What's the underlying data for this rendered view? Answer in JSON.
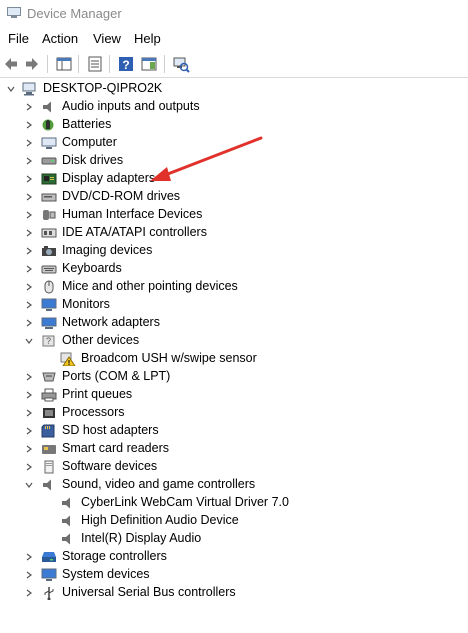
{
  "window": {
    "title": "Device Manager"
  },
  "menu": {
    "file": "File",
    "action": "Action",
    "view": "View",
    "help": "Help"
  },
  "toolbar": {
    "buttons": [
      "back-icon",
      "forward-icon",
      "show-hide-console-tree-icon",
      "properties-icon",
      "help-icon",
      "action-pane-icon",
      "scan-hardware-icon"
    ]
  },
  "tree": {
    "root": "DESKTOP-QIPRO2K",
    "categories": [
      {
        "label": "Audio inputs and outputs",
        "icon": "speaker-icon",
        "expanded": false
      },
      {
        "label": "Batteries",
        "icon": "battery-icon",
        "expanded": false
      },
      {
        "label": "Computer",
        "icon": "computer-icon",
        "expanded": false
      },
      {
        "label": "Disk drives",
        "icon": "disk-drive-icon",
        "expanded": false
      },
      {
        "label": "Display adapters",
        "icon": "display-adapter-icon",
        "expanded": false
      },
      {
        "label": "DVD/CD-ROM drives",
        "icon": "dvd-drive-icon",
        "expanded": false
      },
      {
        "label": "Human Interface Devices",
        "icon": "hid-icon",
        "expanded": false
      },
      {
        "label": "IDE ATA/ATAPI controllers",
        "icon": "ide-controller-icon",
        "expanded": false
      },
      {
        "label": "Imaging devices",
        "icon": "camera-icon",
        "expanded": false
      },
      {
        "label": "Keyboards",
        "icon": "keyboard-icon",
        "expanded": false
      },
      {
        "label": "Mice and other pointing devices",
        "icon": "mouse-icon",
        "expanded": false
      },
      {
        "label": "Monitors",
        "icon": "monitor-icon",
        "expanded": false
      },
      {
        "label": "Network adapters",
        "icon": "network-adapter-icon",
        "expanded": false
      },
      {
        "label": "Other devices",
        "icon": "unknown-device-icon",
        "expanded": true,
        "children": [
          {
            "label": "Broadcom USH w/swipe sensor",
            "icon": "warning-device-icon"
          }
        ]
      },
      {
        "label": "Ports (COM & LPT)",
        "icon": "port-icon",
        "expanded": false
      },
      {
        "label": "Print queues",
        "icon": "printer-icon",
        "expanded": false
      },
      {
        "label": "Processors",
        "icon": "processor-icon",
        "expanded": false
      },
      {
        "label": "SD host adapters",
        "icon": "sd-card-icon",
        "expanded": false
      },
      {
        "label": "Smart card readers",
        "icon": "smart-card-icon",
        "expanded": false
      },
      {
        "label": "Software devices",
        "icon": "software-device-icon",
        "expanded": false
      },
      {
        "label": "Sound, video and game controllers",
        "icon": "speaker-icon",
        "expanded": true,
        "children": [
          {
            "label": "CyberLink WebCam Virtual Driver 7.0",
            "icon": "speaker-icon"
          },
          {
            "label": "High Definition Audio Device",
            "icon": "speaker-icon"
          },
          {
            "label": "Intel(R) Display Audio",
            "icon": "speaker-icon"
          }
        ]
      },
      {
        "label": "Storage controllers",
        "icon": "storage-controller-icon",
        "expanded": false
      },
      {
        "label": "System devices",
        "icon": "system-device-icon",
        "expanded": false
      },
      {
        "label": "Universal Serial Bus controllers",
        "icon": "usb-icon",
        "expanded": false
      }
    ]
  },
  "annotation": {
    "arrow_color": "#e0312b",
    "target": "Display adapters"
  }
}
